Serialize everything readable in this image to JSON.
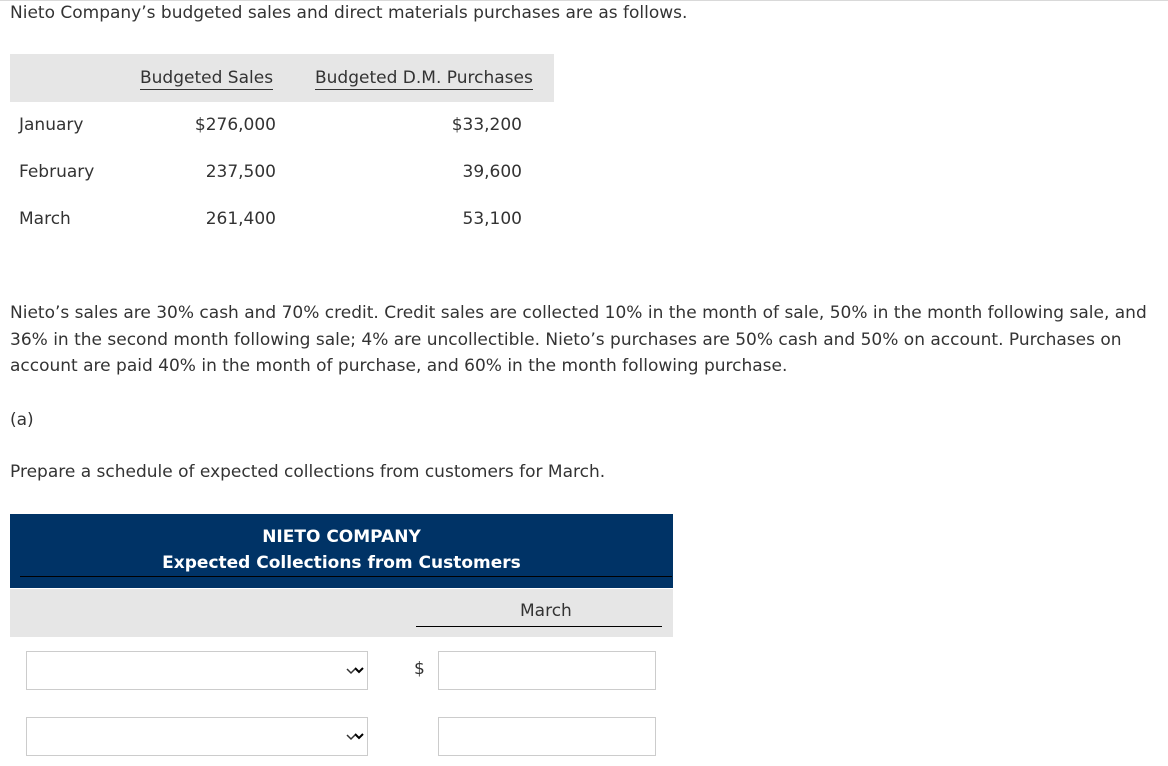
{
  "intro": "Nieto Company’s budgeted sales and direct materials purchases are as follows.",
  "budget_table": {
    "headers": [
      "Budgeted Sales",
      "Budgeted D.M. Purchases"
    ],
    "rows": [
      {
        "month": "January",
        "sales": "$276,000",
        "purchases": "$33,200"
      },
      {
        "month": "February",
        "sales": "237,500",
        "purchases": "39,600"
      },
      {
        "month": "March",
        "sales": "261,400",
        "purchases": "53,100"
      }
    ]
  },
  "paragraph": "Nieto’s sales are 30% cash and 70% credit. Credit sales are collected 10% in the month of sale, 50% in the month following sale, and 36% in the second month following sale; 4% are uncollectible. Nieto’s purchases are 50% cash and 50% on account. Purchases on account are paid 40% in the month of purchase, and 60% in the month following purchase.",
  "part_label": "(a)",
  "prompt": "Prepare a schedule of expected collections from customers for March.",
  "schedule": {
    "company": "NIETO COMPANY",
    "title": "Expected Collections from Customers",
    "column": "March",
    "currency": "$",
    "rows": [
      {
        "select_value": "",
        "amount": ""
      },
      {
        "select_value": "",
        "amount": ""
      }
    ]
  },
  "colors": {
    "header_bg": "#003366",
    "subheader_bg": "#e6e6e6",
    "text": "#333333"
  },
  "icons": {
    "dropdown": "chevron-down-icon"
  }
}
